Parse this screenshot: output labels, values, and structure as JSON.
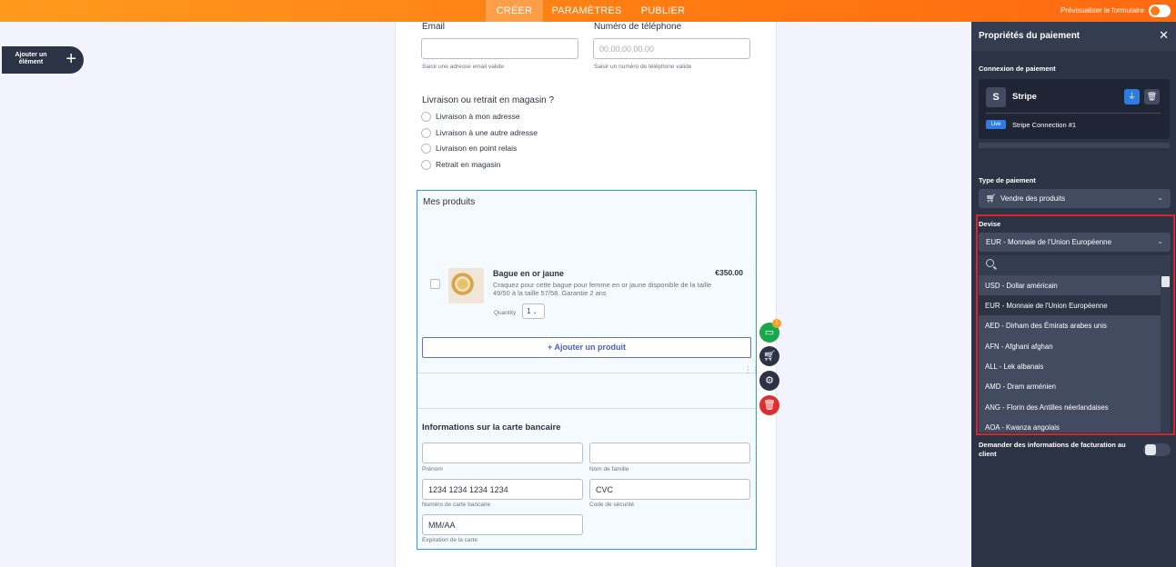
{
  "topbar": {
    "tabs": [
      {
        "label": "CRÉER",
        "active": true
      },
      {
        "label": "PARAMÈTRES",
        "active": false
      },
      {
        "label": "PUBLIER",
        "active": false
      }
    ],
    "preview_label": "Prévisualiser le formulaire"
  },
  "add_element": {
    "label": "Ajouter un élément",
    "icon": "plus-icon"
  },
  "form": {
    "email": {
      "label": "Email",
      "placeholder": "",
      "hint": "Saisir une adresse email valide"
    },
    "phone": {
      "label": "Numéro de téléphone",
      "placeholder": "00.00.00.00.00",
      "hint": "Saisir un numéro de téléphone valide"
    },
    "delivery": {
      "question": "Livraison ou retrait en magasin ?",
      "options": [
        "Livraison à mon adresse",
        "Livraison à une autre adresse",
        "Livraison en point relais",
        "Retrait en magasin"
      ]
    },
    "products": {
      "title": "Mes produits",
      "item": {
        "name": "Bague en or jaune",
        "price": "€350.00",
        "description": "Craquez pour cette bague pour femme en or jaune disponible de la taille 49/50 à la taille 57/58. Garantie 2 ans",
        "quantity_label": "Quantity",
        "quantity_value": "1"
      },
      "add_button": "+ Ajouter un produit"
    },
    "card": {
      "title": "Informations sur la carte bancaire",
      "first_name_hint": "Prénom",
      "last_name_hint": "Nom de famille",
      "number_placeholder": "1234 1234 1234 1234",
      "number_hint": "Numéro de carte bancaire",
      "cvc_placeholder": "CVC",
      "cvc_hint": "Code de sécurité",
      "expiry_placeholder": "MM/AA",
      "expiry_hint": "Expiration de la carte"
    }
  },
  "tools": {
    "badge": "1"
  },
  "panel": {
    "title": "Propriétés du paiement",
    "connection_label": "Connexion de paiement",
    "stripe": {
      "letter": "S",
      "name": "Stripe",
      "live_badge": "Live",
      "connection_name": "Stripe Connection #1"
    },
    "payment_type_label": "Type de paiement",
    "payment_type_value": "Vendre des produits",
    "currency_label": "Devise",
    "currency_value": "EUR - Monnaie de l'Union Européenne",
    "currency_options": [
      "USD - Dollar américain",
      "EUR - Monnaie de l'Union Européenne",
      "AED - Dirham des Émirats arabes unis",
      "AFN - Afghani afghan",
      "ALL - Lek albanais",
      "AMD - Dram arménien",
      "ANG - Florin des Antilles néerlandaises",
      "AOA - Kwanza angolais"
    ],
    "billing_label": "Demander des informations de facturation au client"
  },
  "colors": {
    "accent": "#ff7a12",
    "panel_bg": "#2c3345",
    "highlight_frame": "#d9252a",
    "field_border": "#2f9be8"
  }
}
